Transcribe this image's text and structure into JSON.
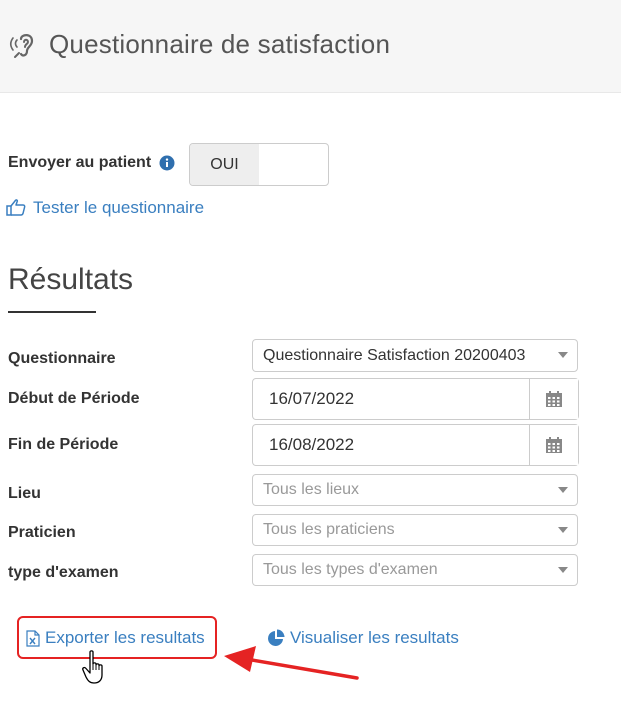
{
  "header": {
    "title": "Questionnaire de satisfaction",
    "icon": "ear-icon"
  },
  "send": {
    "label": "Envoyer au patient",
    "toggle_value": "OUI"
  },
  "test_link": "Tester le questionnaire",
  "section_title": "Résultats",
  "filters": {
    "questionnaire": {
      "label": "Questionnaire",
      "value": "Questionnaire Satisfaction 20200403"
    },
    "start": {
      "label": "Début de Période",
      "value": "16/07/2022"
    },
    "end": {
      "label": "Fin de Période",
      "value": "16/08/2022"
    },
    "lieu": {
      "label": "Lieu",
      "placeholder": "Tous les lieux"
    },
    "praticien": {
      "label": "Praticien",
      "placeholder": "Tous les praticiens"
    },
    "exam": {
      "label": "type d'examen",
      "placeholder": "Tous les types d'examen"
    }
  },
  "actions": {
    "export": "Exporter les resultats",
    "visualize": "Visualiser les resultats"
  },
  "colors": {
    "link": "#3a7fc0",
    "highlight": "#e52323"
  }
}
